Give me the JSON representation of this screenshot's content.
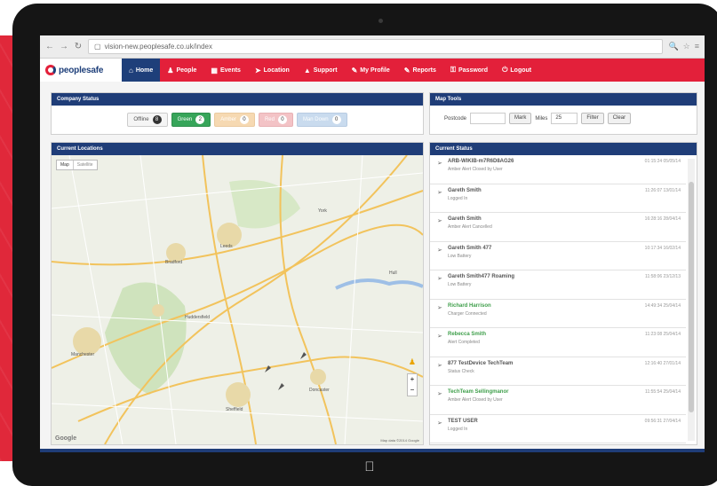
{
  "browser": {
    "url": "vision-new.peoplesafe.co.uk/index"
  },
  "app": {
    "logo_text": "peoplesafe",
    "nav": [
      {
        "label": "Home",
        "icon": "home-icon",
        "glyph": "⌂"
      },
      {
        "label": "People",
        "icon": "person-icon",
        "glyph": "♟"
      },
      {
        "label": "Events",
        "icon": "calendar-icon",
        "glyph": "▦"
      },
      {
        "label": "Location",
        "icon": "location-icon",
        "glyph": "➤"
      },
      {
        "label": "Support",
        "icon": "support-icon",
        "glyph": "▲"
      },
      {
        "label": "My Profile",
        "icon": "profile-icon",
        "glyph": "✎"
      },
      {
        "label": "Reports",
        "icon": "reports-icon",
        "glyph": "✎"
      },
      {
        "label": "Password",
        "icon": "key-icon",
        "glyph": "⚿"
      },
      {
        "label": "Logout",
        "icon": "logout-icon",
        "glyph": "⏻"
      }
    ]
  },
  "company_status": {
    "title": "Company Status",
    "buttons": [
      {
        "label": "Offline",
        "count": "8"
      },
      {
        "label": "Green",
        "count": "2"
      },
      {
        "label": "Amber",
        "count": "0"
      },
      {
        "label": "Red",
        "count": "0"
      },
      {
        "label": "Man Down",
        "count": "0"
      }
    ]
  },
  "map_tools": {
    "title": "Map Tools",
    "postcode_label": "Postcode",
    "mark_button": "Mark",
    "miles_label": "Miles",
    "miles_value": "25",
    "filter_button": "Filter",
    "clear_button": "Clear"
  },
  "locations": {
    "title": "Current Locations",
    "map_type": [
      "Map",
      "Satellite"
    ],
    "places": [
      "Leeds",
      "Bradford",
      "Manchester",
      "Sheffield",
      "Huddersfield",
      "Doncaster",
      "Hull",
      "York"
    ],
    "attribution": "Map data ©2014 Google",
    "google": "Google"
  },
  "current_status": {
    "title": "Current Status",
    "items": [
      {
        "title": "ARB-WIKIB-m7R6D8AG26",
        "sub": "Amber Alert Closed by User",
        "time": "01:15:24 05/05/14",
        "green": false
      },
      {
        "title": "Gareth Smith",
        "sub": "Logged In",
        "time": "11:26:07 13/01/14",
        "green": false
      },
      {
        "title": "Gareth Smith",
        "sub": "Amber Alert Cancelled",
        "time": "16:28:16 28/04/14",
        "green": false
      },
      {
        "title": "Gareth Smith 477",
        "sub": "Low Battery",
        "time": "10:17:34 16/02/14",
        "green": false
      },
      {
        "title": "Gareth Smith477 Roaming",
        "sub": "Low Battery",
        "time": "11:58:06 23/12/13",
        "green": false
      },
      {
        "title": "Richard Harrison",
        "sub": "Charger Connected",
        "time": "14:49:34 25/04/14",
        "green": true
      },
      {
        "title": "Rebecca Smith",
        "sub": "Alert Completed",
        "time": "11:23:08 25/04/14",
        "green": true
      },
      {
        "title": "877 TestDevice TechTeam",
        "sub": "Status Check",
        "time": "12:16:40 27/01/14",
        "green": false
      },
      {
        "title": "TechTeam Sellingmanor",
        "sub": "Amber Alert Closed by User",
        "time": "11:55:54 25/04/14",
        "green": true
      },
      {
        "title": "TEST USER",
        "sub": "Logged In",
        "time": "09:56:31 27/04/14",
        "green": false
      }
    ]
  }
}
